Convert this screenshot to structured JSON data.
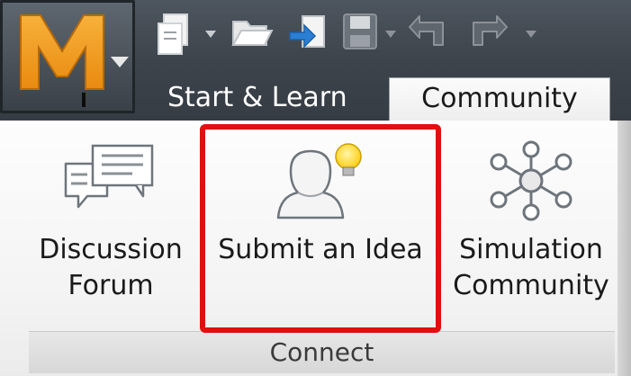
{
  "app": {
    "logo_letter": "M"
  },
  "quick_access": {
    "icons": [
      "new-file-icon",
      "open-folder-icon",
      "import-icon",
      "save-icon",
      "undo-icon",
      "redo-icon"
    ]
  },
  "tabs": [
    {
      "label": "Start & Learn",
      "active": false
    },
    {
      "label": "Community",
      "active": true
    }
  ],
  "panel": {
    "title": "Connect",
    "buttons": [
      {
        "id": "discussion-forum",
        "lines": [
          "Discussion",
          "Forum"
        ],
        "icon": "speech-bubbles-icon"
      },
      {
        "id": "submit-an-idea",
        "lines": [
          "Submit an Idea"
        ],
        "icon": "person-lightbulb-icon",
        "highlighted": true
      },
      {
        "id": "simulation-community",
        "lines": [
          "Simulation",
          "Community"
        ],
        "icon": "network-nodes-icon"
      }
    ]
  },
  "colors": {
    "highlight": "#e01010",
    "logo_orange": "#f39a1d",
    "bulb_yellow": "#ffd21f",
    "topbar": "#3d444c"
  }
}
